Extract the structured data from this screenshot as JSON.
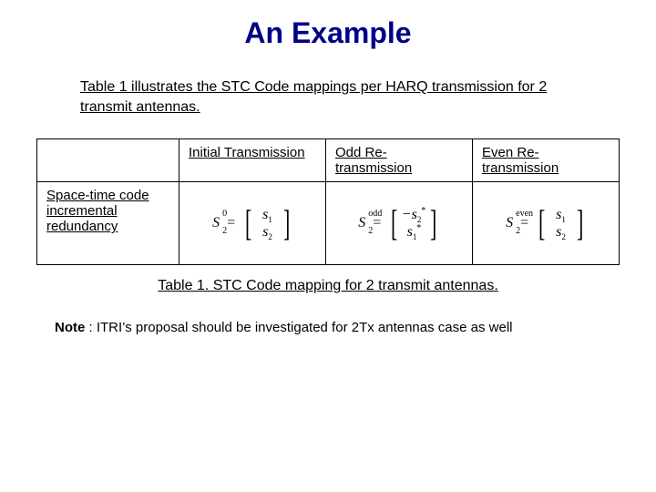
{
  "title": "An Example",
  "intro": "Table 1 illustrates the STC Code mappings per HARQ transmission for 2 transmit antennas.",
  "table": {
    "headers": [
      "",
      "Initial Transmission",
      "Odd Re-transmission",
      "Even Re-transmission"
    ],
    "row_label": "Space-time code incremental redundancy",
    "formulas": {
      "initial": {
        "lhs": {
          "base": "S",
          "sup": "0",
          "sub": "2"
        },
        "rows": [
          {
            "neg": false,
            "base": "s",
            "sub": "1",
            "star": false
          },
          {
            "neg": false,
            "base": "s",
            "sub": "2",
            "star": false
          }
        ]
      },
      "odd": {
        "lhs": {
          "base": "S",
          "sup": "odd",
          "sub": "2"
        },
        "rows": [
          {
            "neg": true,
            "base": "s",
            "sub": "2",
            "star": true
          },
          {
            "neg": false,
            "base": "s",
            "sub": "1",
            "star": true
          }
        ]
      },
      "even": {
        "lhs": {
          "base": "S",
          "sup": "even",
          "sub": "2"
        },
        "rows": [
          {
            "neg": false,
            "base": "s",
            "sub": "1",
            "star": false
          },
          {
            "neg": false,
            "base": "s",
            "sub": "2",
            "star": false
          }
        ]
      }
    }
  },
  "caption": "Table 1. STC Code mapping for 2 transmit antennas.",
  "note_label": "Note",
  "note_body": " : ITRI’s proposal should be investigated for 2Tx antennas case as well"
}
